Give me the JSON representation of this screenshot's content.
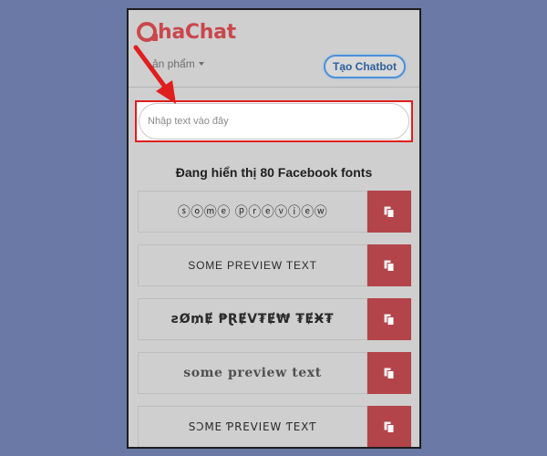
{
  "header": {
    "logo_text": "haChat",
    "nav_products": "ản phẩm",
    "cta_label": "Tạo Chatbot"
  },
  "input": {
    "placeholder": "Nhập text vào đây"
  },
  "fonts": {
    "count_title": "Đang hiển thị 80 Facebook fonts",
    "previews": [
      "ⓢⓞⓜⓔ ⓟⓡⓔⓥⓘⓔⓦ",
      "SOME PREVIEW TEXT",
      "ꙅØ₥Ɇ ₱ⱤɆV₮Ɇ₩ ₮ɆӾ₮",
      "some preview text",
      "SƆMΕ ƤRΕVIΕW ƬΕXƬ"
    ]
  },
  "icons": {
    "copy": "copy-icon",
    "logo": "logo-mark-icon",
    "arrow": "red-arrow-annotation-icon",
    "dropdown": "caret-down-icon"
  },
  "colors": {
    "brand": "#c9474c",
    "copy_button": "#b3444a",
    "highlight": "#e01e1e",
    "cta_border": "#4a90d9",
    "background": "#6a79a5"
  }
}
